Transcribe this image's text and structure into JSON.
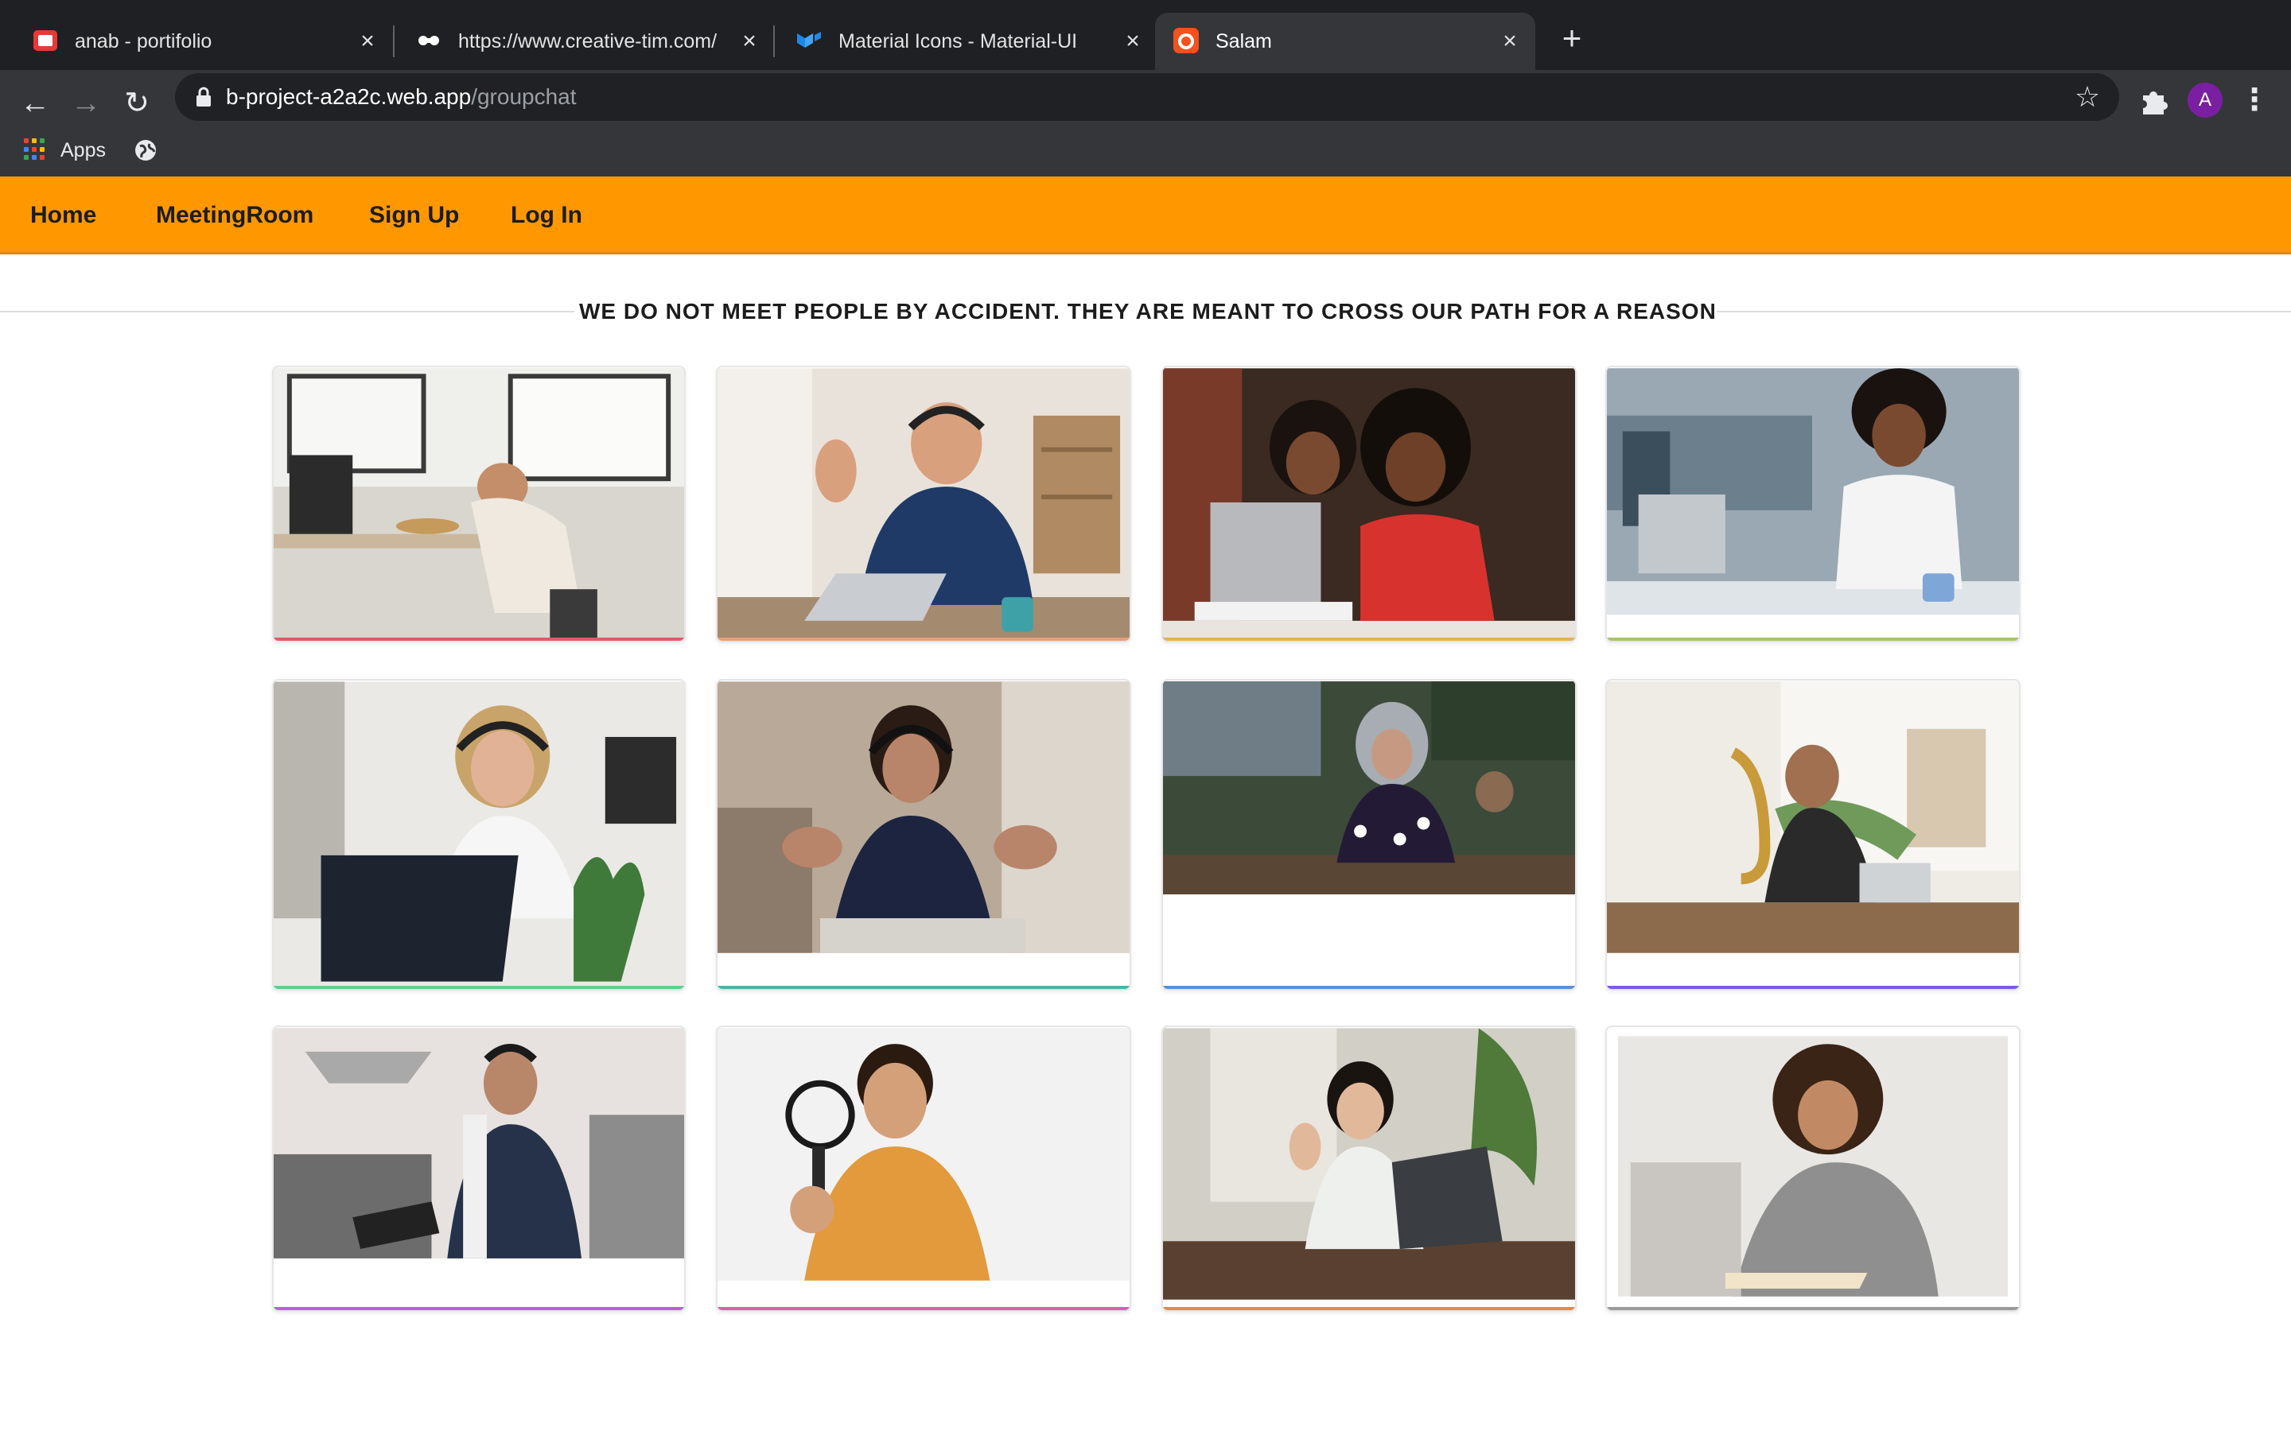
{
  "browser": {
    "tabs": [
      {
        "title": "anab - portifolio",
        "active": false,
        "icon": "red-window-icon"
      },
      {
        "title": "https://www.creative-tim.com/",
        "active": false,
        "icon": "creative-tim-icon"
      },
      {
        "title": "Material Icons - Material-UI",
        "active": false,
        "icon": "material-ui-icon"
      },
      {
        "title": "Salam",
        "active": true,
        "icon": "salam-app-icon"
      }
    ],
    "url_host": "b-project-a2a2c.web.app",
    "url_path": "/groupchat",
    "profile_initial": "A",
    "bookmarks": {
      "apps_label": "Apps"
    }
  },
  "nav": {
    "links": [
      "Home",
      "MeetingRoom",
      "Sign Up",
      "Log In"
    ]
  },
  "heading": "WE DO NOT MEET PEOPLE BY ACCIDENT. THEY ARE MEANT TO CROSS OUR PATH FOR A REASON",
  "cards": [
    {
      "name": "card-man-resting-at-desk",
      "accent": "#e05a6b"
    },
    {
      "name": "card-man-waving-headset",
      "accent": "#e4a07a"
    },
    {
      "name": "card-two-women-laptop",
      "accent": "#e6b24a"
    },
    {
      "name": "card-woman-on-phone",
      "accent": "#a9c46a"
    },
    {
      "name": "card-woman-headset-laptop",
      "accent": "#5fd08a"
    },
    {
      "name": "card-woman-headset-gesturing",
      "accent": "#4cb3a8"
    },
    {
      "name": "card-girl-hijab-writing",
      "accent": "#5a8ee0"
    },
    {
      "name": "card-man-saxophone",
      "accent": "#7d5ae0"
    },
    {
      "name": "card-man-tablet-kitchen",
      "accent": "#c05ae0"
    },
    {
      "name": "card-boy-magnifier",
      "accent": "#e05ab0"
    },
    {
      "name": "card-woman-waving-laptop",
      "accent": "#e08a4a"
    },
    {
      "name": "card-woman-reading",
      "accent": "#9a9a9a"
    }
  ],
  "colors": {
    "nav_background": "#ff9800",
    "browser_frame": "#1f2023",
    "browser_toolbar": "#35363a"
  }
}
